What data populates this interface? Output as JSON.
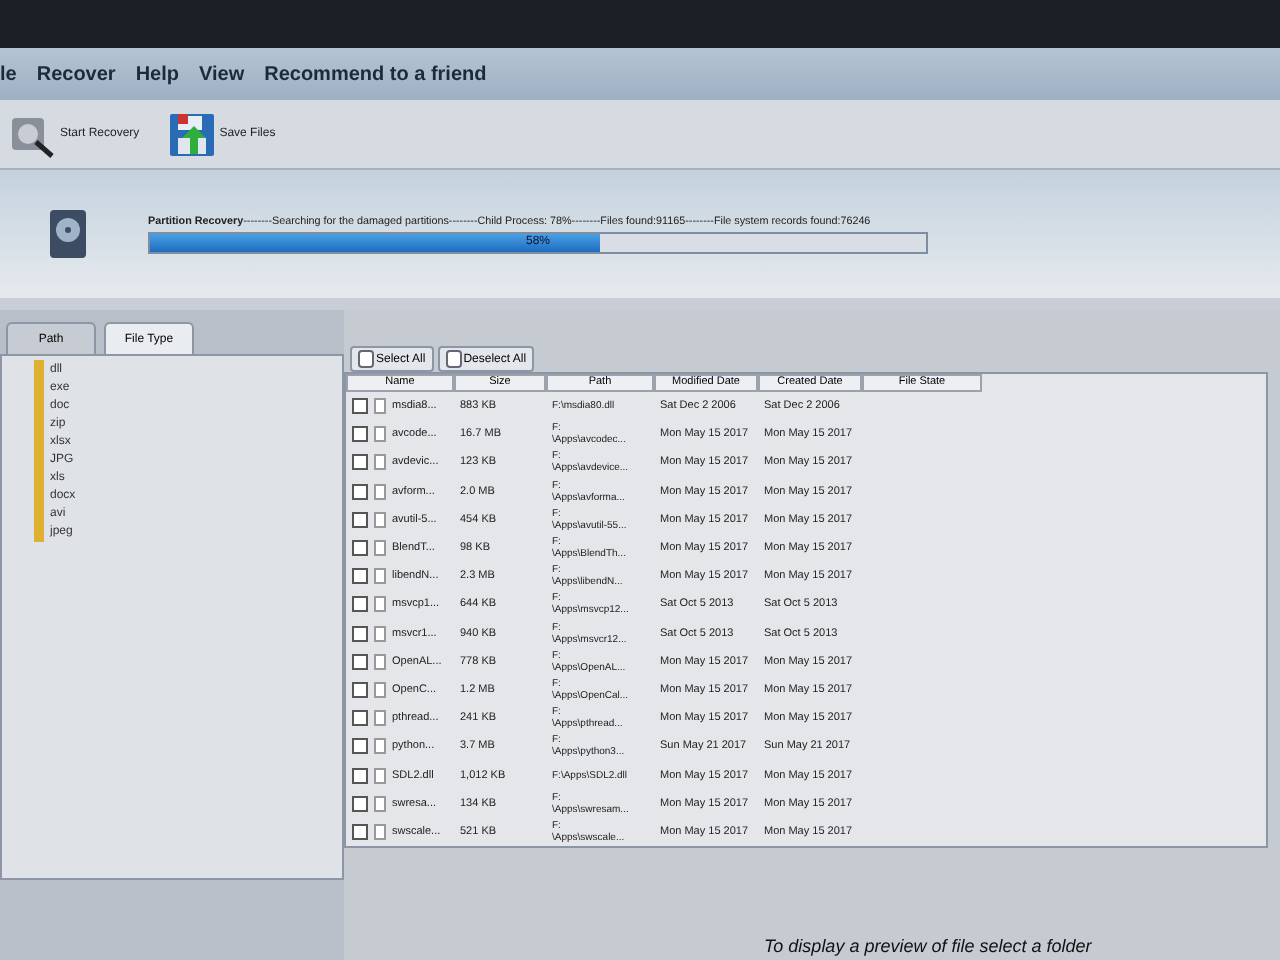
{
  "menu": [
    "le",
    "Recover",
    "Help",
    "View",
    "Recommend to a friend"
  ],
  "toolbar": [
    {
      "kind": "recovery",
      "label": "Start Recovery"
    },
    {
      "kind": "save",
      "label": "Save Files"
    }
  ],
  "status": {
    "text": "**Partition Recovery**--------Searching for the damaged partitions--------Child Process: 78%--------Files found:91165--------File system records found:76246",
    "level": 0.58,
    "reading": "58%"
  },
  "tabs": [
    {
      "label": "Path",
      "selected": false
    },
    {
      "label": "File Type",
      "selected": true
    }
  ],
  "file_types": [
    "dll",
    "exe",
    "doc",
    "zip",
    "xlsx",
    "JPG",
    "xls",
    "docx",
    "avi",
    "jpeg"
  ],
  "actions": [
    "Select All",
    "Deselect All"
  ],
  "table": {
    "columns": [
      "Name",
      "Size",
      "Path",
      "Modified Date",
      "Created Date",
      "File State"
    ],
    "rows": [
      {
        "checked": false,
        "name": "msdia8...",
        "size": "883 KB",
        "path": [
          "F:\\msdia80.dll"
        ],
        "modified": "Sat Dec 2 2006",
        "created": "Sat Dec 2 2006"
      },
      {
        "checked": false,
        "name": "avcode...",
        "size": "16.7 MB",
        "path": [
          "F:",
          "\\Apps\\avcodec..."
        ],
        "modified": "Mon May 15 2017",
        "created": "Mon May 15 2017"
      },
      {
        "checked": false,
        "name": "avdevic...",
        "size": "123 KB",
        "path": [
          "F:",
          "\\Apps\\avdevice..."
        ],
        "modified": "Mon May 15 2017",
        "created": "Mon May 15 2017"
      },
      {
        "checked": false,
        "name": "avform...",
        "size": "2.0 MB",
        "path": [
          "F:",
          "\\Apps\\avforma..."
        ],
        "modified": "Mon May 15 2017",
        "created": "Mon May 15 2017"
      },
      {
        "checked": false,
        "name": "avutil-5...",
        "size": "454 KB",
        "path": [
          "F:",
          "\\Apps\\avutil-55..."
        ],
        "modified": "Mon May 15 2017",
        "created": "Mon May 15 2017"
      },
      {
        "checked": false,
        "name": "BlendT...",
        "size": "98 KB",
        "path": [
          "F:",
          "\\Apps\\BlendTh..."
        ],
        "modified": "Mon May 15 2017",
        "created": "Mon May 15 2017"
      },
      {
        "checked": false,
        "name": "libendN...",
        "size": "2.3 MB",
        "path": [
          "F:",
          "\\Apps\\libendN..."
        ],
        "modified": "Mon May 15 2017",
        "created": "Mon May 15 2017"
      },
      {
        "checked": false,
        "name": "msvcp1...",
        "size": "644 KB",
        "path": [
          "F:",
          "\\Apps\\msvcp12..."
        ],
        "modified": "Sat Oct 5 2013",
        "created": "Sat Oct 5 2013"
      },
      {
        "checked": false,
        "name": "msvcr1...",
        "size": "940 KB",
        "path": [
          "F:",
          "\\Apps\\msvcr12..."
        ],
        "modified": "Sat Oct 5 2013",
        "created": "Sat Oct 5 2013"
      },
      {
        "checked": false,
        "name": "OpenAL...",
        "size": "778 KB",
        "path": [
          "F:",
          "\\Apps\\OpenAL..."
        ],
        "modified": "Mon May 15 2017",
        "created": "Mon May 15 2017"
      },
      {
        "checked": false,
        "name": "OpenC...",
        "size": "1.2 MB",
        "path": [
          "F:",
          "\\Apps\\OpenCal..."
        ],
        "modified": "Mon May 15 2017",
        "created": "Mon May 15 2017"
      },
      {
        "checked": false,
        "name": "pthread...",
        "size": "241 KB",
        "path": [
          "F:",
          "\\Apps\\pthread..."
        ],
        "modified": "Mon May 15 2017",
        "created": "Mon May 15 2017"
      },
      {
        "checked": false,
        "name": "python...",
        "size": "3.7 MB",
        "path": [
          "F:",
          "\\Apps\\python3..."
        ],
        "modified": "Sun May 21 2017",
        "created": "Sun May 21 2017"
      },
      {
        "checked": false,
        "name": "SDL2.dll",
        "size": "1,012 KB",
        "path": [
          "F:\\Apps\\SDL2.dll"
        ],
        "modified": "Mon May 15 2017",
        "created": "Mon May 15 2017"
      },
      {
        "checked": false,
        "name": "swresa...",
        "size": "134 KB",
        "path": [
          "F:",
          "\\Apps\\swresam..."
        ],
        "modified": "Mon May 15 2017",
        "created": "Mon May 15 2017"
      },
      {
        "checked": false,
        "name": "swscale...",
        "size": "521 KB",
        "path": [
          "F:",
          "\\Apps\\swscale..."
        ],
        "modified": "Mon May 15 2017",
        "created": "Mon May 15 2017"
      }
    ]
  },
  "preview_hint": "To display a preview of file select a folder"
}
